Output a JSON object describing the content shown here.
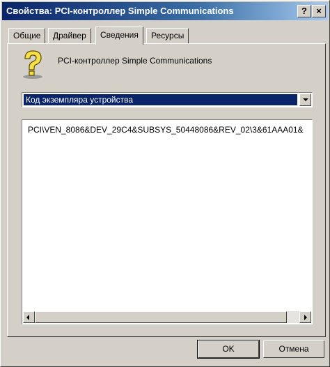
{
  "window": {
    "title": "Свойства: PCI-контроллер Simple Communications",
    "help_button": "?",
    "close_button": "×"
  },
  "tabs": [
    {
      "label": "Общие"
    },
    {
      "label": "Драйвер"
    },
    {
      "label": "Сведения",
      "active": true
    },
    {
      "label": "Ресурсы"
    }
  ],
  "device": {
    "icon": "question-mark-device-icon",
    "name": "PCI-контроллер Simple Communications"
  },
  "property_select": {
    "selected": "Код экземпляра устройства"
  },
  "values_list": {
    "items": [
      "PCI\\VEN_8086&DEV_29C4&SUBSYS_50448086&REV_02\\3&61AAA01&"
    ]
  },
  "buttons": {
    "ok": "OK",
    "cancel": "Отмена"
  },
  "colors": {
    "title_gradient_start": "#0a246a",
    "title_gradient_end": "#a6caf0",
    "selection": "#0a246a",
    "face": "#d4d0c8"
  }
}
